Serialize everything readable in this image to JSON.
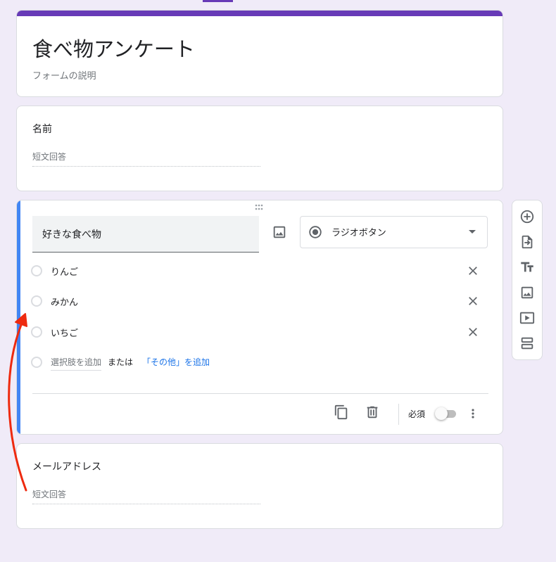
{
  "form": {
    "title": "食べ物アンケート",
    "description": "フォームの説明",
    "accent_color": "#673ab7",
    "background_color": "#f0ebf8"
  },
  "questions": [
    {
      "title": "名前",
      "type": "short-answer",
      "answer_placeholder": "短文回答"
    },
    {
      "title": "好きな食べ物",
      "type_label": "ラジオボタン",
      "options": [
        {
          "label": "りんご"
        },
        {
          "label": "みかん"
        },
        {
          "label": "いちご"
        }
      ],
      "add_option_label": "選択肢を追加",
      "or_label": "または",
      "add_other_label": "「その他」を追加",
      "required_label": "必須",
      "required": false,
      "active_color": "#4285f4",
      "link_color": "#1a73e8"
    },
    {
      "title": "メールアドレス",
      "type": "short-answer",
      "answer_placeholder": "短文回答"
    }
  ],
  "icons": {
    "question_image": "image-icon",
    "type_select": "radio-button-icon",
    "dropdown": "caret-down-icon",
    "remove_option": "close-icon",
    "duplicate": "copy-icon",
    "delete": "trash-icon",
    "more": "more-vert-icon"
  },
  "sidebar": {
    "buttons": [
      {
        "name": "add-question-button",
        "icon": "add-circle-icon"
      },
      {
        "name": "import-questions-button",
        "icon": "import-icon"
      },
      {
        "name": "add-title-button",
        "icon": "text-icon"
      },
      {
        "name": "add-image-button",
        "icon": "image-icon"
      },
      {
        "name": "add-video-button",
        "icon": "video-icon"
      },
      {
        "name": "add-section-button",
        "icon": "section-icon"
      }
    ]
  },
  "annotation": {
    "color": "#ee2a0f",
    "shape": "curved-arrow"
  }
}
